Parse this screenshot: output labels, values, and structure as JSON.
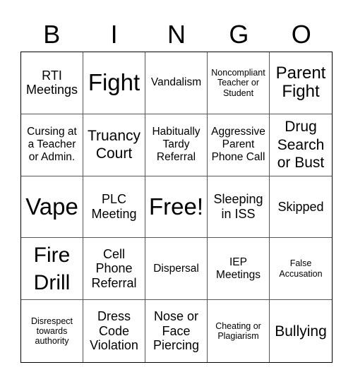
{
  "title_letters": [
    "B",
    "I",
    "N",
    "G",
    "O"
  ],
  "cells": [
    {
      "text": "RTI Meetings",
      "size": "s-md"
    },
    {
      "text": "Fight",
      "size": "s-xxxl"
    },
    {
      "text": "Vandalism",
      "size": "s-sm"
    },
    {
      "text": "Noncompliant Teacher or Student",
      "size": "s-xs"
    },
    {
      "text": "Parent Fight",
      "size": "s-xl"
    },
    {
      "text": "Cursing at a Teacher or Admin.",
      "size": "s-sm"
    },
    {
      "text": "Truancy Court",
      "size": "s-lg"
    },
    {
      "text": "Habitually Tardy Referral",
      "size": "s-sm"
    },
    {
      "text": "Aggressive Parent Phone Call",
      "size": "s-sm"
    },
    {
      "text": "Drug Search or Bust",
      "size": "s-lg"
    },
    {
      "text": "Vape",
      "size": "s-xxxl"
    },
    {
      "text": "PLC Meeting",
      "size": "s-md"
    },
    {
      "text": "Free!",
      "size": "s-xxxl"
    },
    {
      "text": "Sleeping in ISS",
      "size": "s-md"
    },
    {
      "text": "Skipped",
      "size": "s-md"
    },
    {
      "text": "Fire Drill",
      "size": "s-xxl"
    },
    {
      "text": "Cell Phone Referral",
      "size": "s-md"
    },
    {
      "text": "Dispersal",
      "size": "s-sm"
    },
    {
      "text": "IEP Meetings",
      "size": "s-sm"
    },
    {
      "text": "False Accusation",
      "size": "s-xs"
    },
    {
      "text": "Disrespect towards authority",
      "size": "s-xs"
    },
    {
      "text": "Dress Code Violation",
      "size": "s-md"
    },
    {
      "text": "Nose or Face Piercing",
      "size": "s-md"
    },
    {
      "text": "Cheating or Plagiarism",
      "size": "s-xs"
    },
    {
      "text": "Bullying",
      "size": "s-lg"
    }
  ]
}
